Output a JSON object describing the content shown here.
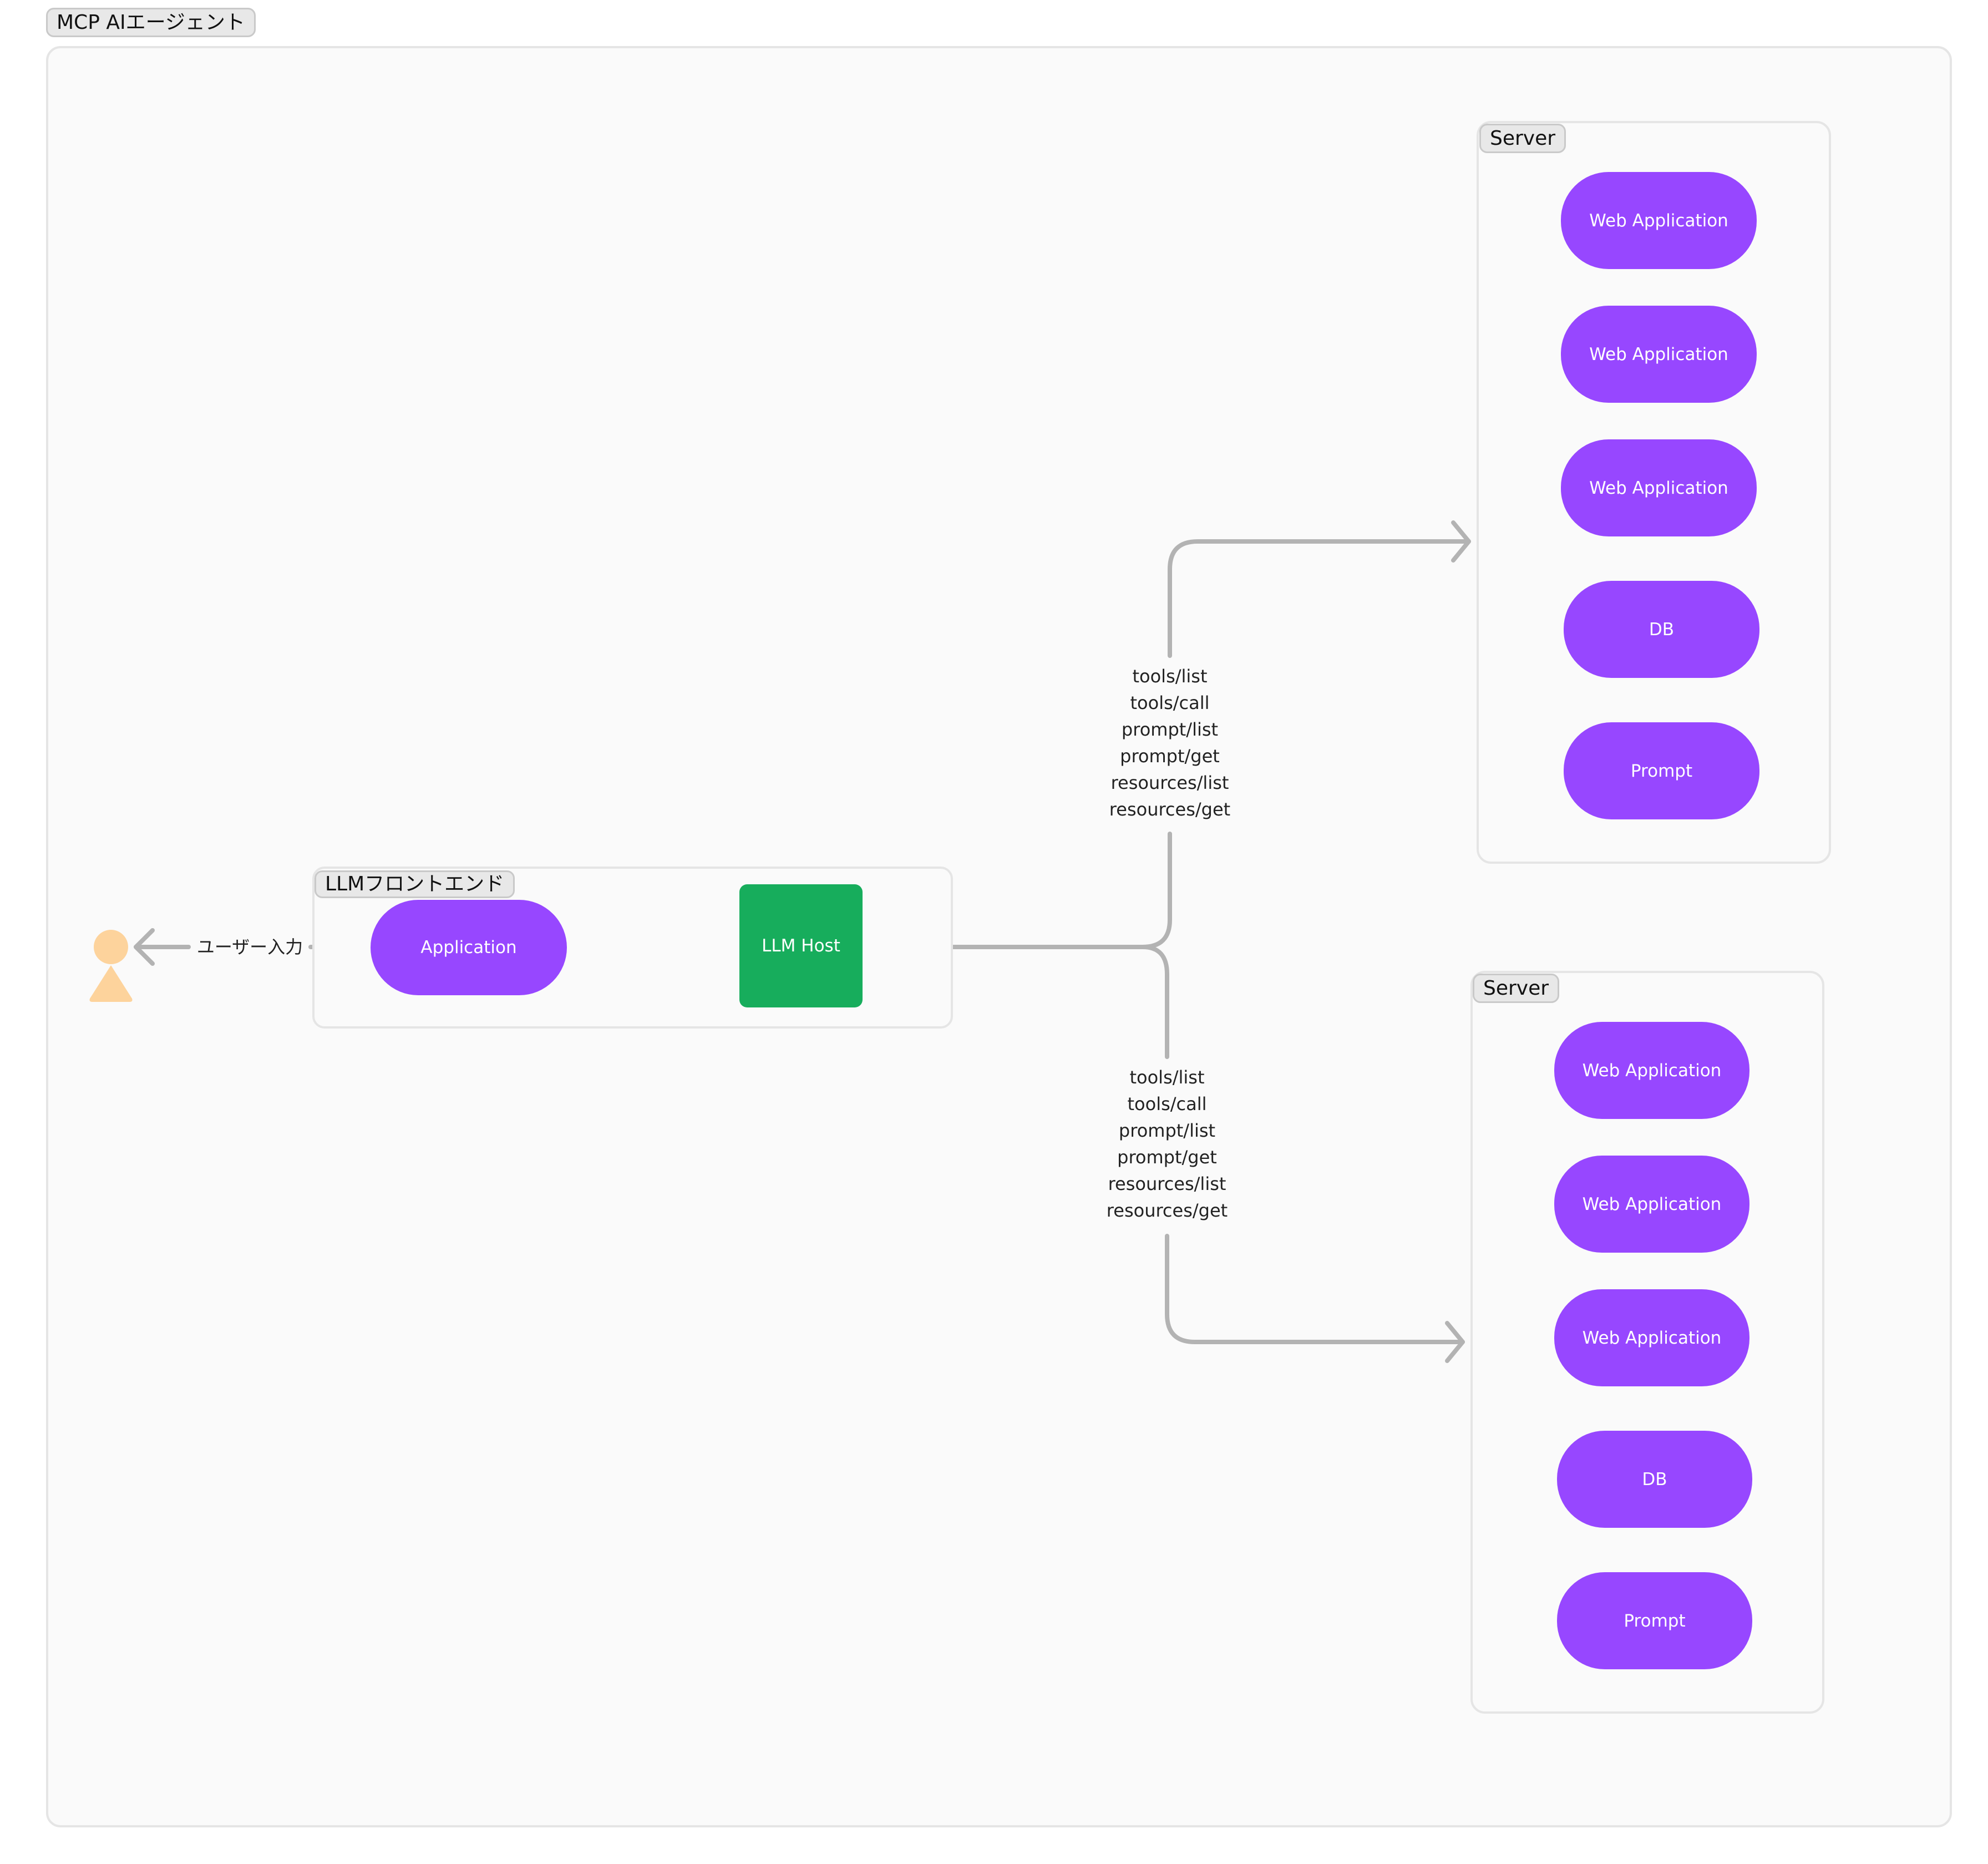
{
  "diagram": {
    "title": "MCP AIエージェント",
    "actor": {
      "name": "user",
      "edge_label": "ユーザー入力"
    },
    "frontend": {
      "label": "LLMフロントエンド",
      "application": "Application",
      "host": "LLM Host"
    },
    "servers": [
      {
        "label": "Server",
        "nodes": [
          "Web Application",
          "Web Application",
          "Web Application",
          "DB",
          "Prompt"
        ],
        "edge_labels": [
          "tools/list",
          "tools/call",
          "prompt/list",
          "prompt/get",
          "resources/list",
          "resources/get"
        ]
      },
      {
        "label": "Server",
        "nodes": [
          "Web Application",
          "Web Application",
          "Web Application",
          "DB",
          "Prompt"
        ],
        "edge_labels": [
          "tools/list",
          "tools/call",
          "prompt/list",
          "prompt/get",
          "resources/list",
          "resources/get"
        ]
      }
    ],
    "colors": {
      "node_purple": "#9747ff",
      "node_green": "#17ad5c",
      "actor": "#fdd39c",
      "edge": "#b3b3b3"
    }
  }
}
